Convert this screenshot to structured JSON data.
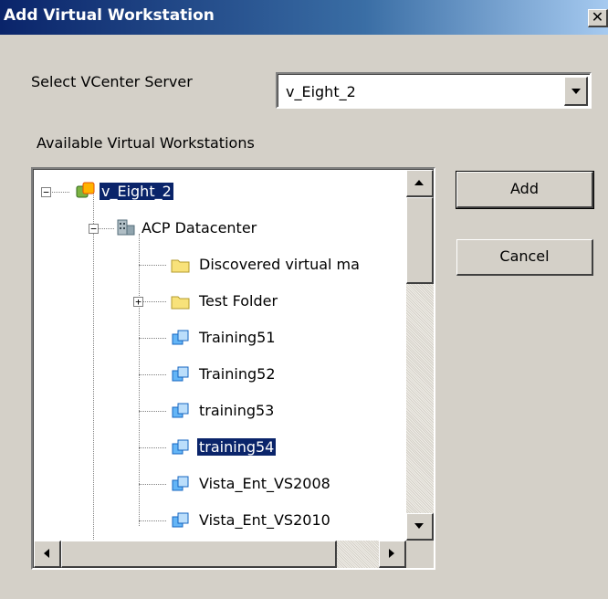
{
  "window": {
    "title": "Add Virtual Workstation",
    "close_label": "✕"
  },
  "server": {
    "label": "Select VCenter Server",
    "value": "v_Eight_2"
  },
  "workstations": {
    "label": "Available Virtual Workstations",
    "tree": [
      {
        "label": "v_Eight_2",
        "icon": "vcenter-icon",
        "expander": "−",
        "selected": true
      },
      {
        "label": "ACP Datacenter",
        "icon": "datacenter-icon",
        "expander": "−"
      },
      {
        "label": "Discovered virtual ma",
        "icon": "folder-icon"
      },
      {
        "label": "Test Folder",
        "icon": "folder-icon",
        "expander": "+"
      },
      {
        "label": "Training51",
        "icon": "vm-icon"
      },
      {
        "label": "Training52",
        "icon": "vm-icon"
      },
      {
        "label": "training53",
        "icon": "vm-icon"
      },
      {
        "label": "training54",
        "icon": "vm-icon",
        "selected": true
      },
      {
        "label": "Vista_Ent_VS2008",
        "icon": "vm-icon"
      },
      {
        "label": "Vista_Ent_VS2010",
        "icon": "vm-icon"
      }
    ]
  },
  "buttons": {
    "add": "Add",
    "cancel": "Cancel"
  },
  "colors": {
    "titlebar": "#0a246a",
    "selection": "#0a246a",
    "face": "#d4d0c8"
  }
}
